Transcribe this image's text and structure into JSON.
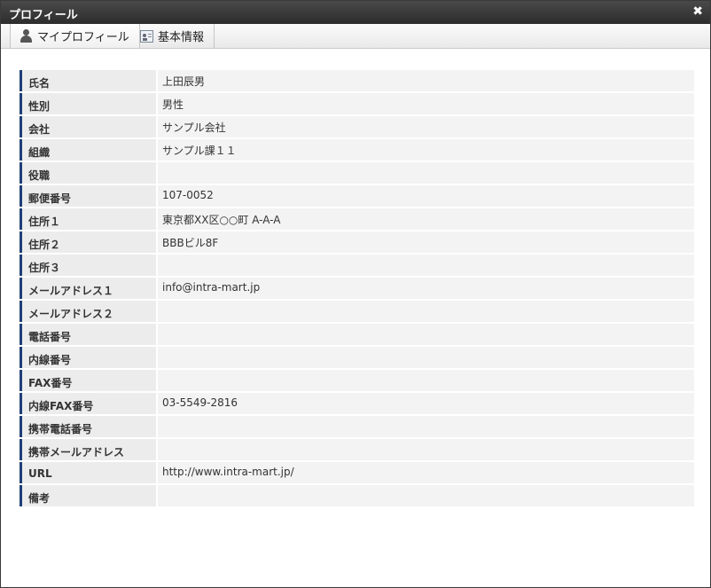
{
  "window": {
    "title": "プロフィール",
    "close_glyph": "✖"
  },
  "tabs": [
    {
      "label": "マイプロフィール",
      "icon": "person-icon"
    },
    {
      "label": "基本情報",
      "icon": "id-card-icon"
    }
  ],
  "profile": [
    {
      "label": "氏名",
      "value": "上田辰男"
    },
    {
      "label": "性別",
      "value": "男性"
    },
    {
      "label": "会社",
      "value": "サンプル会社"
    },
    {
      "label": "組織",
      "value": "サンプル課１１"
    },
    {
      "label": "役職",
      "value": ""
    },
    {
      "label": "郵便番号",
      "value": "107-0052"
    },
    {
      "label": "住所１",
      "value": "東京都XX区○○町 A-A-A"
    },
    {
      "label": "住所２",
      "value": "BBBビル8F"
    },
    {
      "label": "住所３",
      "value": ""
    },
    {
      "label": "メールアドレス１",
      "value": "info@intra-mart.jp"
    },
    {
      "label": "メールアドレス２",
      "value": ""
    },
    {
      "label": "電話番号",
      "value": ""
    },
    {
      "label": "内線番号",
      "value": ""
    },
    {
      "label": "FAX番号",
      "value": ""
    },
    {
      "label": "内線FAX番号",
      "value": "03-5549-2816"
    },
    {
      "label": "携帯電話番号",
      "value": ""
    },
    {
      "label": "携帯メールアドレス",
      "value": ""
    },
    {
      "label": "URL",
      "value": "http://www.intra-mart.jp/"
    },
    {
      "label": "備考",
      "value": ""
    }
  ]
}
